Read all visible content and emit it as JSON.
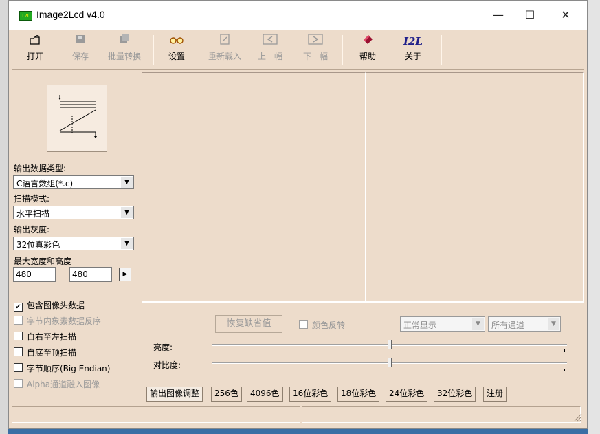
{
  "window": {
    "title": "Image2Lcd v4.0",
    "app_icon_text": "I2L"
  },
  "window_controls": {
    "minimize": "—",
    "maximize": "☐",
    "close": "✕"
  },
  "toolbar": [
    {
      "label": "打开",
      "icon": "open-folder-icon",
      "enabled": true
    },
    {
      "label": "保存",
      "icon": "save-icon",
      "enabled": false
    },
    {
      "label": "批量转换",
      "icon": "batch-convert-icon",
      "enabled": false
    },
    {
      "label": "设置",
      "icon": "settings-glasses-icon",
      "enabled": true
    },
    {
      "label": "重新载入",
      "icon": "reload-icon",
      "enabled": false
    },
    {
      "label": "上一幅",
      "icon": "previous-icon",
      "enabled": false
    },
    {
      "label": "下一幅",
      "icon": "next-icon",
      "enabled": false
    },
    {
      "label": "帮助",
      "icon": "help-book-icon",
      "enabled": true
    },
    {
      "label": "关于",
      "icon": "about-i2l-icon",
      "about_mark": "I2L",
      "enabled": true
    }
  ],
  "left": {
    "output_type_label": "输出数据类型:",
    "output_type_value": "C语言数组(*.c)",
    "scan_mode_label": "扫描模式:",
    "scan_mode_value": "水平扫描",
    "gray_label": "输出灰度:",
    "gray_value": "32位真彩色",
    "max_size_label": "最大宽度和高度",
    "max_width": "480",
    "max_height": "480",
    "checkboxes": [
      {
        "label": "包含图像头数据",
        "checked": true,
        "enabled": true
      },
      {
        "label": "字节内象素数据反序",
        "checked": false,
        "enabled": false
      },
      {
        "label": "自右至左扫描",
        "checked": false,
        "enabled": true
      },
      {
        "label": "自底至顶扫描",
        "checked": false,
        "enabled": true
      },
      {
        "label": "字节顺序(Big Endian)",
        "checked": false,
        "enabled": true
      },
      {
        "label": "Alpha通道融入图像",
        "checked": false,
        "enabled": false
      }
    ]
  },
  "controls": {
    "restore_default": "恢复缺省值",
    "invert_color": "颜色反转",
    "display_mode": "正常显示",
    "channel": "所有通道",
    "brightness_label": "亮度:",
    "contrast_label": "对比度:",
    "brightness_level": 0.5,
    "contrast_level": 0.5
  },
  "tabs": [
    "输出图像调整",
    "256色",
    "4096色",
    "16位彩色",
    "18位彩色",
    "24位彩色",
    "32位彩色",
    "注册"
  ],
  "colors": {
    "face": "#eddccb",
    "disabled_text": "#9a9a9a"
  }
}
